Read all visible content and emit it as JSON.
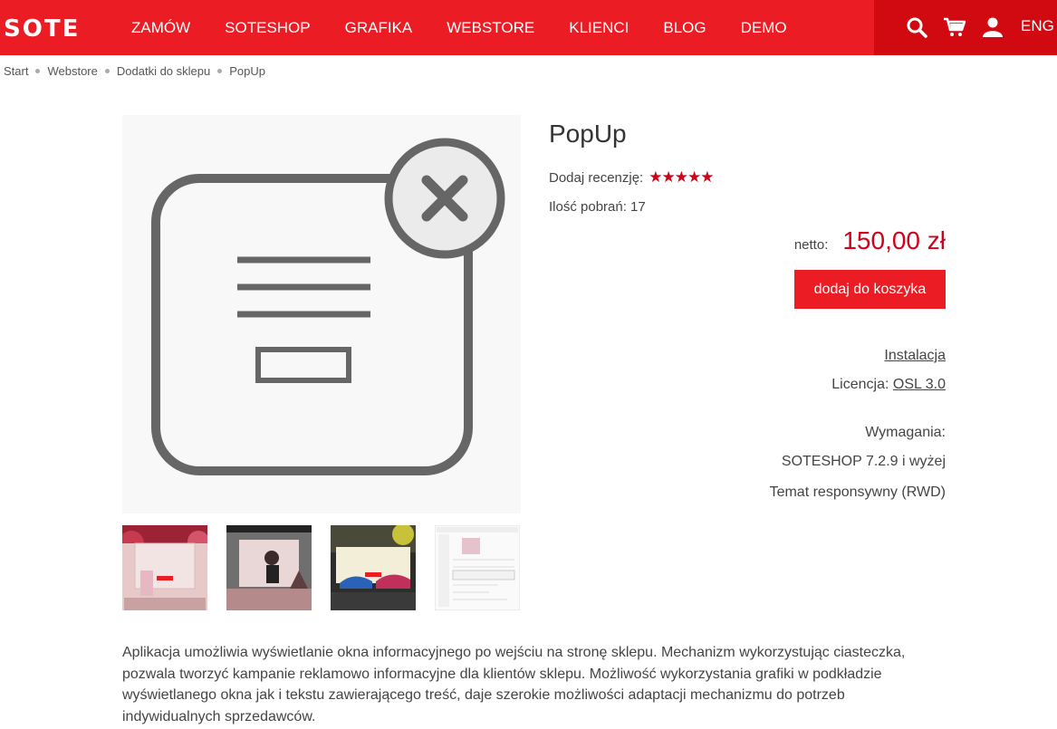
{
  "header": {
    "logo": "SOTE",
    "nav": [
      "ZAMÓW",
      "SOTESHOP",
      "GRAFIKA",
      "WEBSTORE",
      "KLIENCI",
      "BLOG",
      "DEMO"
    ],
    "lang": "ENG",
    "icons": [
      "search-icon",
      "cart-icon",
      "user-icon"
    ]
  },
  "breadcrumb": [
    "Start",
    "Webstore",
    "Dodatki do sklepu",
    "PopUp"
  ],
  "product": {
    "title": "PopUp",
    "review_label": "Dodaj recenzję:",
    "stars": "★★★★★",
    "rating": 5,
    "downloads": "Ilość pobrań: 17",
    "price_label": "netto:",
    "price": "150,00 zł",
    "add_to_cart": "dodaj do koszyka",
    "installation": "Instalacja",
    "license_label": "Licencja:",
    "license": "OSL 3.0",
    "requirements_label": "Wymagania:",
    "requirements": [
      "SOTESHOP 7.2.9 i wyżej",
      "Temat responsywny (RWD)"
    ]
  },
  "description": "Aplikacja umożliwia wyświetlanie okna informacyjnego po wejściu na stronę sklepu. Mechanizm wykorzystując ciasteczka, pozwala tworzyć kampanie reklamowo informacyjne dla klientów sklepu. Możliwość wykorzystania grafiki w podkładzie wyświetlanego okna jak i tekstu zawierającego treść, daje szerokie możliwości adaptacji mechanizmu do potrzeb indywidualnych sprzedawców.",
  "colors": {
    "brand_red": "#ec1c24",
    "brand_dark": "#d00a10",
    "price_red": "#d0021b"
  }
}
